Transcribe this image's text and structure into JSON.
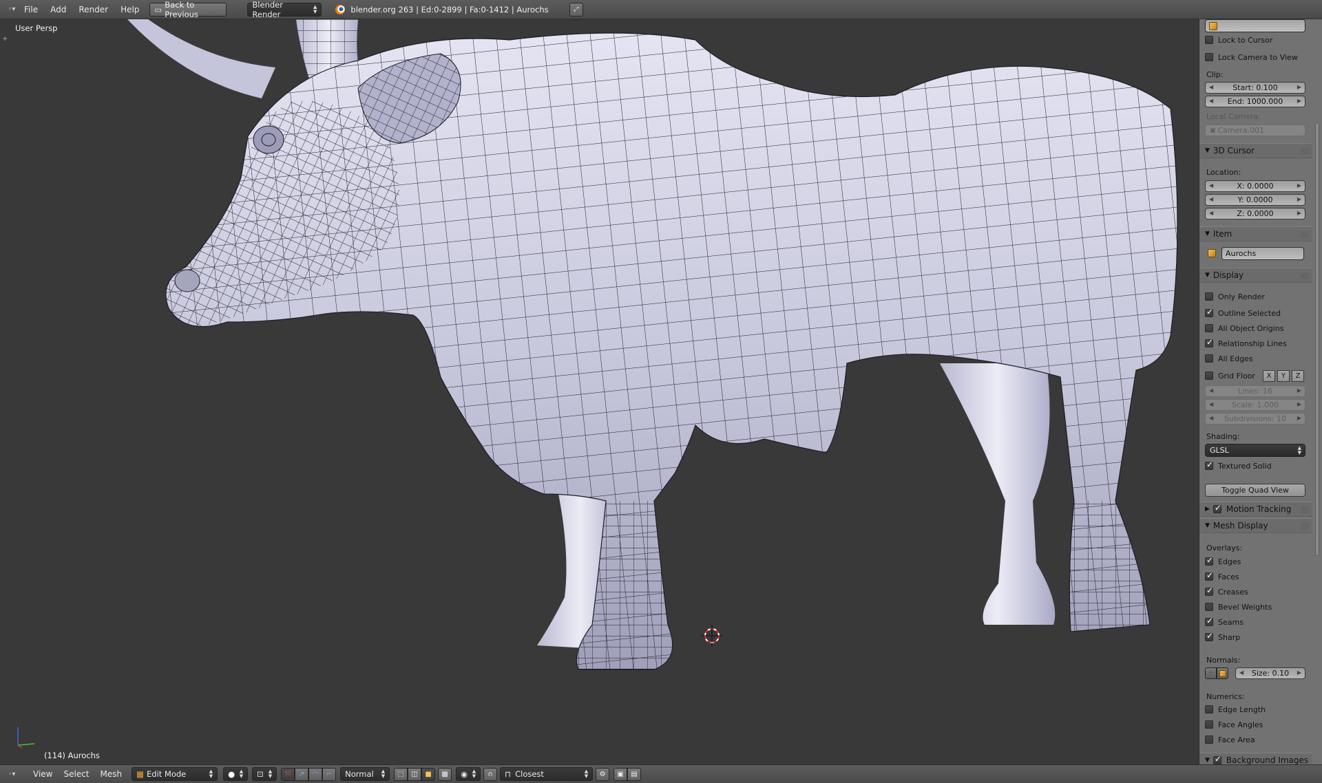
{
  "top_header": {
    "menu": [
      "File",
      "Add",
      "Render",
      "Help"
    ],
    "back_button": "Back to Previous",
    "render_engine": "Blender Render",
    "stats": "blender.org 263 | Ed:0-2899 | Fa:0-1412 | Aurochs"
  },
  "viewport": {
    "view_label": "User Persp",
    "object_label": "(114) Aurochs"
  },
  "npanel": {
    "lock_to_cursor": "Lock to Cursor",
    "lock_camera": "Lock Camera to View",
    "clip_label": "Clip:",
    "clip_start": "Start: 0.100",
    "clip_end": "End: 1000.000",
    "local_camera_label": "Local Camera:",
    "local_camera": "Camera.001",
    "cursor_header": "3D Cursor",
    "location_label": "Location:",
    "loc_x": "X: 0.0000",
    "loc_y": "Y: 0.0000",
    "loc_z": "Z: 0.0000",
    "item_header": "Item",
    "item_name": "Aurochs",
    "display_header": "Display",
    "only_render": "Only Render",
    "outline_selected": "Outline Selected",
    "all_object_origins": "All Object Origins",
    "relationship_lines": "Relationship Lines",
    "all_edges": "All Edges",
    "grid_floor": "Grid Floor",
    "axis_x": "X",
    "axis_y": "Y",
    "axis_z": "Z",
    "lines": "Lines: 16",
    "scale": "Scale: 1.000",
    "subdivisions": "Subdivisions: 10",
    "shading_label": "Shading:",
    "shading_value": "GLSL",
    "textured_solid": "Textured Solid",
    "toggle_quad": "Toggle Quad View",
    "motion_tracking": "Motion Tracking",
    "mesh_display_header": "Mesh Display",
    "overlays_label": "Overlays:",
    "edges": "Edges",
    "faces": "Faces",
    "creases": "Creases",
    "bevel_weights": "Bevel Weights",
    "seams": "Seams",
    "sharp": "Sharp",
    "normals_label": "Normals:",
    "normals_size": "Size: 0.10",
    "numerics_label": "Numerics:",
    "edge_length": "Edge Length",
    "face_angles": "Face Angles",
    "face_area": "Face Area",
    "background_images": "Background Images"
  },
  "checkbox_states": {
    "lock_to_cursor": false,
    "lock_camera": false,
    "only_render": false,
    "outline_selected": true,
    "all_object_origins": false,
    "relationship_lines": true,
    "all_edges": false,
    "grid_floor": false,
    "textured_solid": true,
    "motion_tracking": true,
    "edges": true,
    "faces": true,
    "creases": true,
    "bevel_weights": false,
    "seams": true,
    "sharp": true,
    "edge_length": false,
    "face_angles": false,
    "face_area": false,
    "background_images": true
  },
  "bottom_header": {
    "menu": [
      "View",
      "Select",
      "Mesh"
    ],
    "mode": "Edit Mode",
    "orientation": "Normal",
    "snap_target": "Closest"
  },
  "colors": {
    "viewport_bg": "#393939",
    "mesh_fill": "#c9c9df",
    "panel_bg": "#727272",
    "header_bg": "#4a4a4a"
  }
}
